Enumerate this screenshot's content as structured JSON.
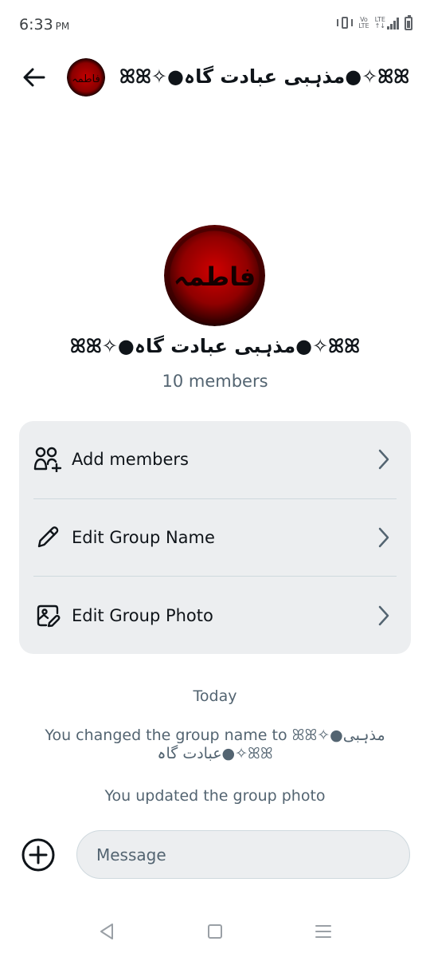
{
  "status_bar": {
    "time": "6:33",
    "period": "PM",
    "network_label_1": "Vo",
    "network_label_2": "LTE",
    "icons": [
      "vibrate-icon",
      "volte-icon",
      "lte-signal-icon",
      "battery-icon"
    ]
  },
  "header": {
    "title": "ꕤꕤ✧●مذہبی عبادت گاہ●✧ꕤꕤ",
    "back_icon": "arrow-left-icon"
  },
  "group": {
    "name": "ꕤꕤ✧●مذہبی عبادت گاہ●✧ꕤꕤ",
    "members": "10 members",
    "avatar_text": "فاطمہ"
  },
  "options": [
    {
      "label": "Add members",
      "icon": "add-people-icon"
    },
    {
      "label": "Edit Group Name",
      "icon": "pencil-icon"
    },
    {
      "label": "Edit Group Photo",
      "icon": "edit-photo-icon"
    }
  ],
  "chat": {
    "date_label": "Today",
    "messages": [
      "You changed the group name to ꕤꕤ✧●مذہبی عبادت گاہ●✧ꕤꕤ",
      "You updated the group photo"
    ]
  },
  "composer": {
    "placeholder": "Message",
    "add_icon": "plus-circle-icon"
  },
  "colors": {
    "text_primary": "#0f1419",
    "text_secondary": "#536471",
    "card_bg": "#eceef0",
    "avatar_red": "#8b0000"
  }
}
